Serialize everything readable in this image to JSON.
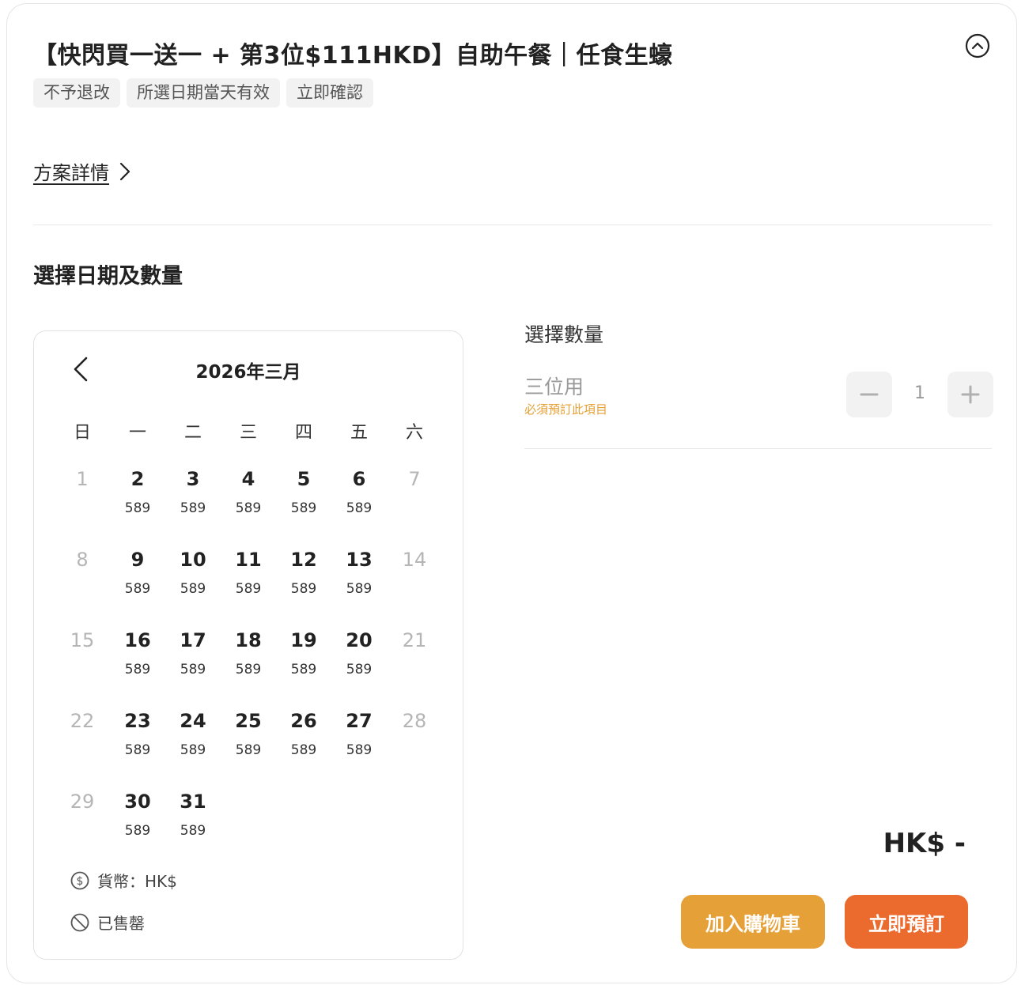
{
  "package": {
    "title": "【快閃買一送一 + 第3位$111HKD】自助午餐｜任食生蠔",
    "tags": [
      "不予退改",
      "所選日期當天有效",
      "立即確認"
    ],
    "details_link": "方案詳情"
  },
  "section": {
    "title": "選擇日期及數量"
  },
  "calendar": {
    "month_label": "2026年三月",
    "weekdays": [
      "日",
      "一",
      "二",
      "三",
      "四",
      "五",
      "六"
    ],
    "days": [
      {
        "d": "1",
        "p": "",
        "disabled": true
      },
      {
        "d": "2",
        "p": "589"
      },
      {
        "d": "3",
        "p": "589"
      },
      {
        "d": "4",
        "p": "589"
      },
      {
        "d": "5",
        "p": "589"
      },
      {
        "d": "6",
        "p": "589"
      },
      {
        "d": "7",
        "p": "",
        "disabled": true
      },
      {
        "d": "8",
        "p": "",
        "disabled": true
      },
      {
        "d": "9",
        "p": "589"
      },
      {
        "d": "10",
        "p": "589"
      },
      {
        "d": "11",
        "p": "589"
      },
      {
        "d": "12",
        "p": "589"
      },
      {
        "d": "13",
        "p": "589"
      },
      {
        "d": "14",
        "p": "",
        "disabled": true
      },
      {
        "d": "15",
        "p": "",
        "disabled": true
      },
      {
        "d": "16",
        "p": "589"
      },
      {
        "d": "17",
        "p": "589"
      },
      {
        "d": "18",
        "p": "589"
      },
      {
        "d": "19",
        "p": "589"
      },
      {
        "d": "20",
        "p": "589"
      },
      {
        "d": "21",
        "p": "",
        "disabled": true
      },
      {
        "d": "22",
        "p": "",
        "disabled": true
      },
      {
        "d": "23",
        "p": "589"
      },
      {
        "d": "24",
        "p": "589"
      },
      {
        "d": "25",
        "p": "589"
      },
      {
        "d": "26",
        "p": "589"
      },
      {
        "d": "27",
        "p": "589"
      },
      {
        "d": "28",
        "p": "",
        "disabled": true
      },
      {
        "d": "29",
        "p": "",
        "disabled": true
      },
      {
        "d": "30",
        "p": "589"
      },
      {
        "d": "31",
        "p": "589"
      }
    ],
    "currency_label": "貨幣：HK$",
    "sold_out_label": "已售罄"
  },
  "quantity": {
    "title": "選擇數量",
    "item_name": "三位用",
    "item_note": "必須預訂此項目",
    "value": "1"
  },
  "summary": {
    "total": "HK$ -",
    "add_to_cart": "加入購物車",
    "book_now": "立即預訂"
  },
  "colors": {
    "accent_orange": "#eb6a2e",
    "accent_yellow": "#e6a038"
  }
}
